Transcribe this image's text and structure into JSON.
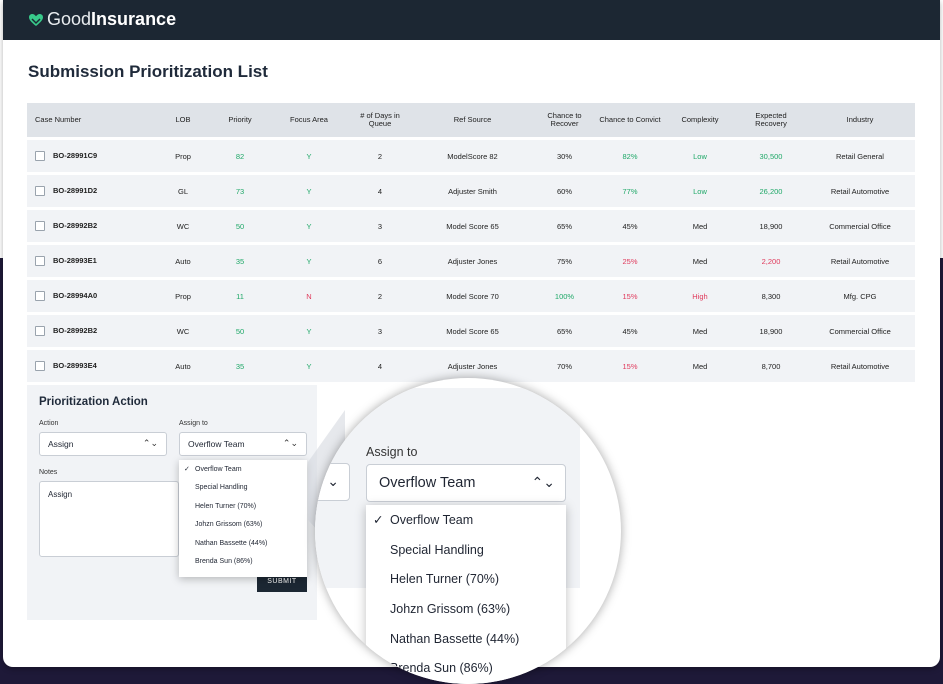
{
  "app": {
    "brand_part1": "Good",
    "brand_part2": "Insurance"
  },
  "page_title": "Submission Prioritization List",
  "table": {
    "headers": [
      "Case Number",
      "LOB",
      "Priority",
      "Focus Area",
      "# of Days in Queue",
      "Ref Source",
      "Chance to Recover",
      "Chance to Convict",
      "Complexity",
      "Expected Recovery",
      "Industry"
    ],
    "rows": [
      {
        "case": "BO-28991C9",
        "lob": "Prop",
        "priority": "82",
        "focus": "Y",
        "days": "2",
        "ref": "ModelScore 82",
        "recover": "30%",
        "convict": "82%",
        "complexity": "Low",
        "expected": "30,500",
        "industry": "Retail General"
      },
      {
        "case": "BO-28991D2",
        "lob": "GL",
        "priority": "73",
        "focus": "Y",
        "days": "4",
        "ref": "Adjuster Smith",
        "recover": "60%",
        "convict": "77%",
        "complexity": "Low",
        "expected": "26,200",
        "industry": "Retail Automotive"
      },
      {
        "case": "BO-28992B2",
        "lob": "WC",
        "priority": "50",
        "focus": "Y",
        "days": "3",
        "ref": "Model Score 65",
        "recover": "65%",
        "convict": "45%",
        "complexity": "Med",
        "expected": "18,900",
        "industry": "Commercial Office"
      },
      {
        "case": "BO-28993E1",
        "lob": "Auto",
        "priority": "35",
        "focus": "Y",
        "days": "6",
        "ref": "Adjuster Jones",
        "recover": "75%",
        "convict": "25%",
        "complexity": "Med",
        "expected": "2,200",
        "industry": "Retail Automotive"
      },
      {
        "case": "BO-28994A0",
        "lob": "Prop",
        "priority": "11",
        "focus": "N",
        "days": "2",
        "ref": "Model Score 70",
        "recover": "100%",
        "convict": "15%",
        "complexity": "High",
        "expected": "8,300",
        "industry": "Mfg. CPG"
      },
      {
        "case": "BO-28992B2",
        "lob": "WC",
        "priority": "50",
        "focus": "Y",
        "days": "3",
        "ref": "Model Score 65",
        "recover": "65%",
        "convict": "45%",
        "complexity": "Med",
        "expected": "18,900",
        "industry": "Commercial Office"
      },
      {
        "case": "BO-28993E4",
        "lob": "Auto",
        "priority": "35",
        "focus": "Y",
        "days": "4",
        "ref": "Adjuster Jones",
        "recover": "70%",
        "convict": "15%",
        "complexity": "Med",
        "expected": "8,700",
        "industry": "Retail Automotive"
      }
    ]
  },
  "action_panel": {
    "title": "Prioritization Action",
    "action_label": "Action",
    "action_value": "Assign",
    "assign_label": "Assign to",
    "assign_value": "Overflow Team",
    "notes_label": "Notes",
    "notes_value": "Assign",
    "submit_label": "SUBMIT",
    "options": [
      "Overflow Team",
      "Special Handling",
      "Helen Turner (70%)",
      "Johzn Grissom (63%)",
      "Nathan Bassette (44%)",
      "Brenda Sun (86%)"
    ],
    "checkmark": "✓",
    "chevron": "⌃⌄"
  },
  "colors": {
    "green": "#1fa868",
    "red": "#e03a5c",
    "navbar": "#1c2733"
  }
}
